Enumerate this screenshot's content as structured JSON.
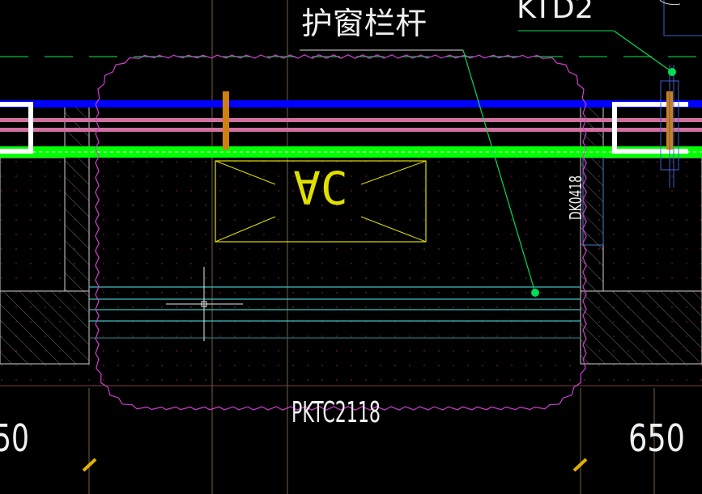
{
  "drawing": {
    "annotation_label": "护窗栏杆",
    "top_right_label": "KTD2",
    "window_tag": "PKTC2118",
    "ac_unit_label": "AC",
    "side_opening_tag": "DK0418",
    "dim_left": "50",
    "dim_right": "650"
  },
  "colors": {
    "background": "#000000",
    "blue_line": "#0000ff",
    "pink_line": "#d070a0",
    "green_line": "#00ff00",
    "white_line": "#ffffff",
    "magenta_cloud": "#d040d0",
    "orange_post": "#d08010",
    "cyan_line": "#40c0c0",
    "yellow_line": "#e0e000",
    "leader_green": "#00dd55",
    "red_dot": "#a03040",
    "grey_hatch": "#909090"
  }
}
